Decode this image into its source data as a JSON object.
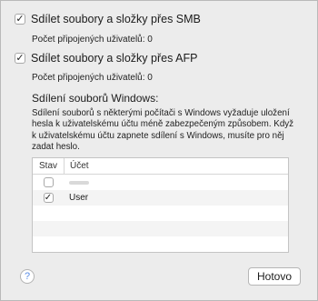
{
  "smb": {
    "label": "Sdílet soubory a složky přes SMB",
    "checked": true,
    "check_glyph": "✓",
    "users_text": "Počet připojených uživatelů: 0"
  },
  "afp": {
    "label": "Sdílet soubory a složky přes AFP",
    "checked": true,
    "check_glyph": "✓",
    "users_text": "Počet připojených uživatelů: 0"
  },
  "windows": {
    "title": "Sdílení souborů Windows:",
    "description": "Sdílení souborů s některými počítači s Windows vyžaduje uložení hesla k uživatelskému účtu méně zabezpečeným způsobem. Když k uživatelskému účtu zapnete sdílení s Windows, musíte pro něj zadat heslo."
  },
  "table": {
    "headers": {
      "status": "Stav",
      "account": "Účet"
    },
    "rows": [
      {
        "account": "",
        "checked": false,
        "check_glyph": ""
      },
      {
        "account": "User",
        "checked": true,
        "check_glyph": "✓"
      }
    ]
  },
  "buttons": {
    "help_glyph": "?",
    "done": "Hotovo"
  }
}
